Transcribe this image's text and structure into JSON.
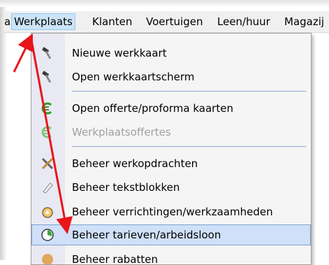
{
  "menubar": {
    "items": [
      {
        "label": "a",
        "active": false
      },
      {
        "label": "Werkplaats",
        "active": true
      },
      {
        "label": "Klanten",
        "active": false
      },
      {
        "label": "Voertuigen",
        "active": false
      },
      {
        "label": "Leen/huur",
        "active": false
      },
      {
        "label": "Magazij",
        "active": false
      }
    ]
  },
  "dropdown": {
    "items": [
      {
        "label": "Nieuwe werkkaart",
        "icon": "hammer-icon",
        "enabled": true
      },
      {
        "label": "Open werkkaartscherm",
        "icon": "hammer-icon",
        "enabled": true
      },
      {
        "label": "Open offerte/proforma kaarten",
        "icon": "euro-icon",
        "enabled": true
      },
      {
        "label": "Werkplaatsoffertes",
        "icon": "euro-icon",
        "enabled": false
      },
      {
        "label": "Beheer werkopdrachten",
        "icon": "tools-icon",
        "enabled": true
      },
      {
        "label": "Beheer tekstblokken",
        "icon": "pen-icon",
        "enabled": true
      },
      {
        "label": "Beheer verrichtingen/werkzaamheden",
        "icon": "gear-clock-icon",
        "enabled": true
      },
      {
        "label": "Beheer tarieven/arbeidsloon",
        "icon": "clock-icon",
        "enabled": true,
        "highlighted": true
      },
      {
        "label": "Beheer rabatten",
        "icon": "discount-icon",
        "enabled": true
      }
    ]
  },
  "annotation": {
    "arrow_color": "#e8151b"
  }
}
